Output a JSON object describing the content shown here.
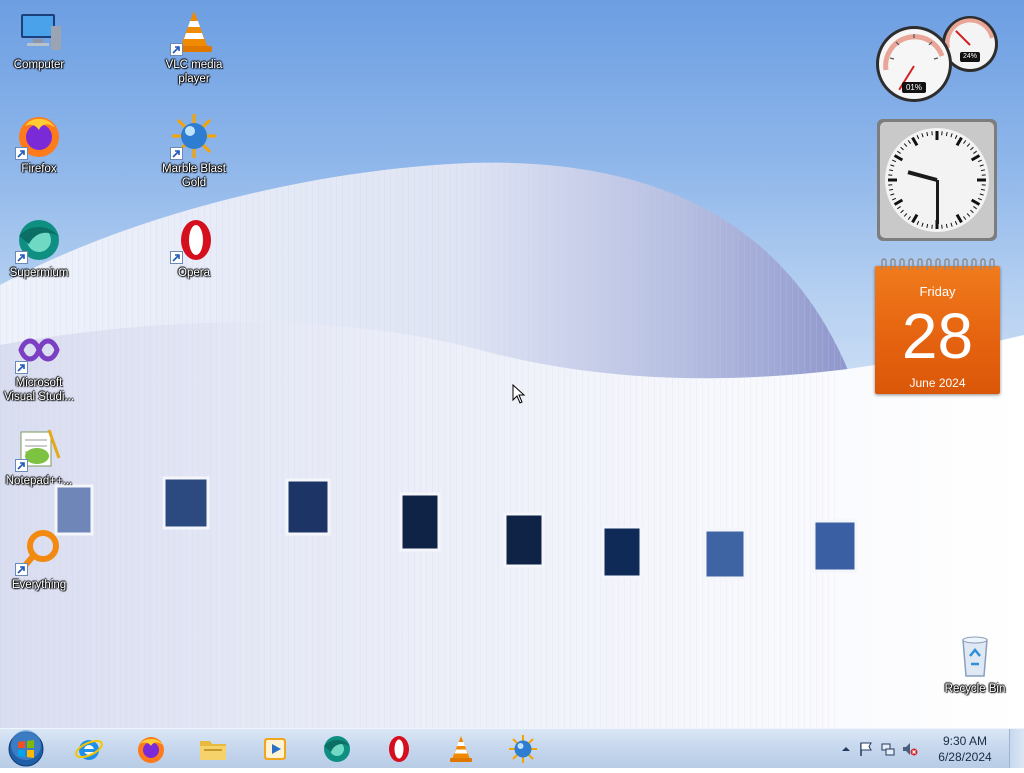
{
  "desktop": {
    "icons": [
      {
        "label": "Computer",
        "icon": "computer-icon"
      },
      {
        "label": "VLC media player",
        "icon": "vlc-icon"
      },
      {
        "label": "Firefox",
        "icon": "firefox-icon"
      },
      {
        "label": "Marble Blast Gold",
        "icon": "marble-blast-icon"
      },
      {
        "label": "Supermium",
        "icon": "supermium-icon"
      },
      {
        "label": "Opera",
        "icon": "opera-icon"
      },
      {
        "label": "Microsoft Visual Studi...",
        "icon": "visual-studio-icon"
      },
      {
        "label": "Notepad++...",
        "icon": "notepad-plus-plus-icon"
      },
      {
        "label": "Everything",
        "icon": "everything-search-icon"
      },
      {
        "label": "Recycle Bin",
        "icon": "recycle-bin-icon"
      }
    ]
  },
  "gadgets": {
    "cpu_meter": {
      "cpu": "01%",
      "memory": "24%",
      "cpu_fraction": 0.01,
      "memory_fraction": 0.24
    },
    "clock": {
      "hour": 9,
      "minute": 30
    },
    "calendar": {
      "weekday": "Friday",
      "day": "28",
      "month_year": "June 2024"
    }
  },
  "taskbar": {
    "pinned": [
      {
        "name": "internet-explorer",
        "icon": "internet-explorer-icon"
      },
      {
        "name": "firefox",
        "icon": "firefox-icon"
      },
      {
        "name": "file-explorer",
        "icon": "folder-icon"
      },
      {
        "name": "media-player",
        "icon": "media-player-icon"
      },
      {
        "name": "supermium",
        "icon": "supermium-icon"
      },
      {
        "name": "opera",
        "icon": "opera-icon"
      },
      {
        "name": "vlc",
        "icon": "vlc-icon"
      },
      {
        "name": "marble-blast",
        "icon": "marble-blast-icon"
      }
    ],
    "tray": {
      "time": "9:30 AM",
      "date": "6/28/2024",
      "icons": [
        "show-hidden-icons-arrow-icon",
        "action-center-flag-icon",
        "network-icon",
        "volume-muted-icon"
      ]
    }
  },
  "colors": {
    "accent_orange": "#e66410",
    "taskbar": "#c7d8ee",
    "sky": "#8eb6ea"
  }
}
